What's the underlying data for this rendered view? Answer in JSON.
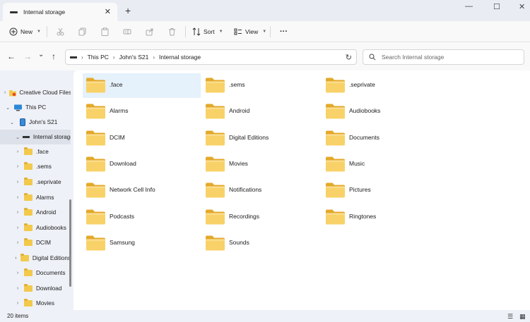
{
  "window": {
    "tab_title": "Internal storage",
    "tab_close": "✕",
    "new_tab": "+",
    "minimize": "—",
    "maximize": "☐",
    "close": "✕"
  },
  "toolbar": {
    "new_label": "New",
    "sort_label": "Sort",
    "view_label": "View",
    "more_label": "···"
  },
  "nav": {
    "back": "←",
    "forward": "→",
    "recent": "⌄",
    "up": "↑",
    "refresh": "↻"
  },
  "address": {
    "crumbs": [
      "This PC",
      "John's S21",
      "Internal storage"
    ]
  },
  "search": {
    "placeholder": "Search Internal storage"
  },
  "sidebar": {
    "items": [
      {
        "label": "Creative Cloud Files"
      },
      {
        "label": "This PC"
      },
      {
        "label": "John's S21"
      },
      {
        "label": "Internal storage"
      },
      {
        "label": ".face"
      },
      {
        "label": ".sems"
      },
      {
        "label": ".seprivate"
      },
      {
        "label": "Alarms"
      },
      {
        "label": "Android"
      },
      {
        "label": "Audiobooks"
      },
      {
        "label": "DCIM"
      },
      {
        "label": "Digital Editions"
      },
      {
        "label": "Documents"
      },
      {
        "label": "Download"
      },
      {
        "label": "Movies"
      }
    ]
  },
  "files": [
    {
      "name": ".face"
    },
    {
      "name": ".sems"
    },
    {
      "name": ".seprivate"
    },
    {
      "name": "Alarms"
    },
    {
      "name": "Android"
    },
    {
      "name": "Audiobooks"
    },
    {
      "name": "DCIM"
    },
    {
      "name": "Digital Editions"
    },
    {
      "name": "Documents"
    },
    {
      "name": "Download"
    },
    {
      "name": "Movies"
    },
    {
      "name": "Music"
    },
    {
      "name": "Network Cell Info"
    },
    {
      "name": "Notifications"
    },
    {
      "name": "Pictures"
    },
    {
      "name": "Podcasts"
    },
    {
      "name": "Recordings"
    },
    {
      "name": "Ringtones"
    },
    {
      "name": "Samsung"
    },
    {
      "name": "Sounds"
    }
  ],
  "status": {
    "count": "20 items"
  },
  "colors": {
    "accent": "#0067c0",
    "folder": "#f5c842",
    "selection": "#e5f1fb"
  }
}
